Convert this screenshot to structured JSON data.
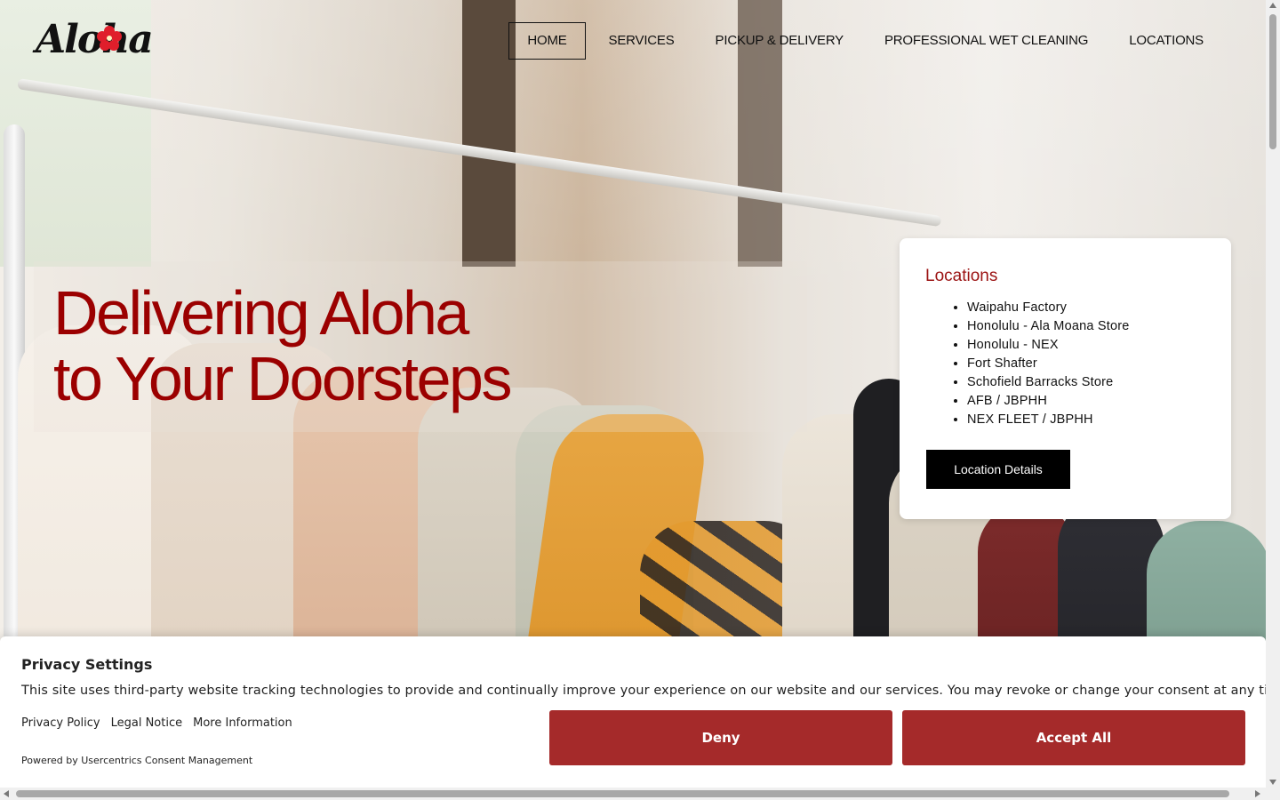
{
  "brand": {
    "logo_text": "Aloha"
  },
  "nav": {
    "items": [
      {
        "label": "HOME",
        "active": true
      },
      {
        "label": "SERVICES",
        "active": false
      },
      {
        "label": "PICKUP & DELIVERY",
        "active": false
      },
      {
        "label": "PROFESSIONAL WET CLEANING",
        "active": false
      },
      {
        "label": "LOCATIONS",
        "active": false
      }
    ]
  },
  "hero": {
    "title_line1": "Delivering Aloha",
    "title_line2": "to Your Doorsteps"
  },
  "locations_card": {
    "title": "Locations",
    "items": [
      "Waipahu Factory",
      "Honolulu - Ala Moana Store",
      "Honolulu - NEX",
      "Fort Shafter",
      "Schofield Barracks Store",
      "AFB / JBPHH",
      "NEX FLEET / JBPHH"
    ],
    "button_label": "Location Details"
  },
  "consent": {
    "title": "Privacy Settings",
    "text": "This site uses third-party website tracking technologies to provide and continually improve your experience on our website and our services. You may revoke or change your consent at any time.",
    "links": [
      "Privacy Policy",
      "Legal Notice",
      "More Information"
    ],
    "powered_by": "Powered by Usercentrics Consent Management",
    "deny_label": "Deny",
    "accept_label": "Accept All"
  },
  "colors": {
    "accent_red": "#9b0000",
    "consent_button": "#a52a2a",
    "hibiscus": "#e01e2b"
  },
  "icons": [
    "hibiscus-icon"
  ]
}
